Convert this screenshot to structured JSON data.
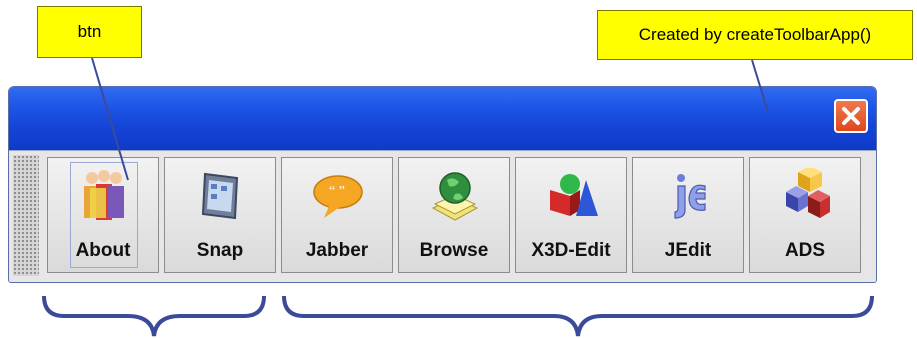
{
  "annotations": {
    "btn_callout": "btn",
    "created_callout": "Created by createToolbarApp()"
  },
  "window": {
    "close_icon": "close-icon",
    "title_color": "#1f56e8"
  },
  "toolbar": {
    "buttons": [
      {
        "label": "About",
        "icon": "people-icon"
      },
      {
        "label": "Snap",
        "icon": "tablet-icon"
      },
      {
        "label": "Jabber",
        "icon": "speech-bubble-icon"
      },
      {
        "label": "Browse",
        "icon": "globe-icon"
      },
      {
        "label": "X3D-Edit",
        "icon": "shapes-3d-icon"
      },
      {
        "label": "JEdit",
        "icon": "jedit-logo-icon"
      },
      {
        "label": "ADS",
        "icon": "cubes-icon"
      }
    ]
  }
}
